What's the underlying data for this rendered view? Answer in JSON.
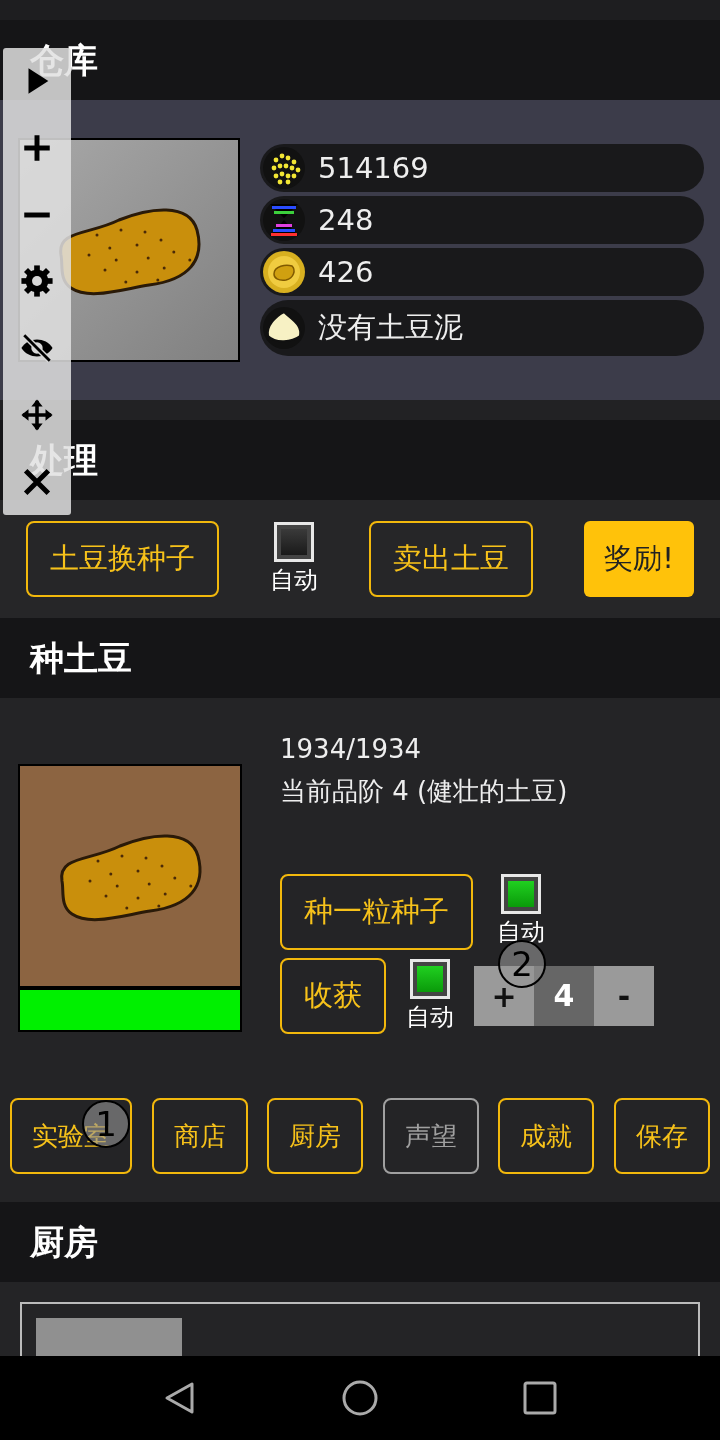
{
  "storage": {
    "title": "仓库",
    "resources": [
      {
        "kind": "seeds",
        "value": "514169"
      },
      {
        "kind": "dna",
        "value": "248"
      },
      {
        "kind": "coin",
        "value": "426"
      },
      {
        "kind": "mash",
        "value": "没有土豆泥"
      }
    ]
  },
  "processing": {
    "title": "处理",
    "actions": [
      {
        "kind": "button",
        "label": "土豆换种子"
      },
      {
        "kind": "checkbox",
        "label": "自动",
        "checked": false
      },
      {
        "kind": "button",
        "label": "卖出土豆"
      },
      {
        "kind": "reward",
        "label": "奖励!"
      }
    ]
  },
  "planting": {
    "title": "种土豆",
    "progress_text": "1934/1934",
    "quality": "当前品阶 4 (健壮的土豆)",
    "growth": {
      "level": 1.0
    },
    "plant_button": "种一粒种子",
    "plant_auto": {
      "label": "自动",
      "checked": true
    },
    "harvest_button": "收获",
    "harvest_auto": {
      "label": "自动",
      "checked": true
    },
    "stepper": {
      "plus": "+",
      "value": "4",
      "minus": "-"
    }
  },
  "nav": [
    {
      "label": "实验室",
      "disabled": false
    },
    {
      "label": "商店",
      "disabled": false
    },
    {
      "label": "厨房",
      "disabled": false
    },
    {
      "label": "声望",
      "disabled": true
    },
    {
      "label": "成就",
      "disabled": false
    },
    {
      "label": "保存",
      "disabled": false
    }
  ],
  "kitchen": {
    "title": "厨房"
  },
  "markers": [
    {
      "label": "1"
    },
    {
      "label": "2"
    }
  ]
}
